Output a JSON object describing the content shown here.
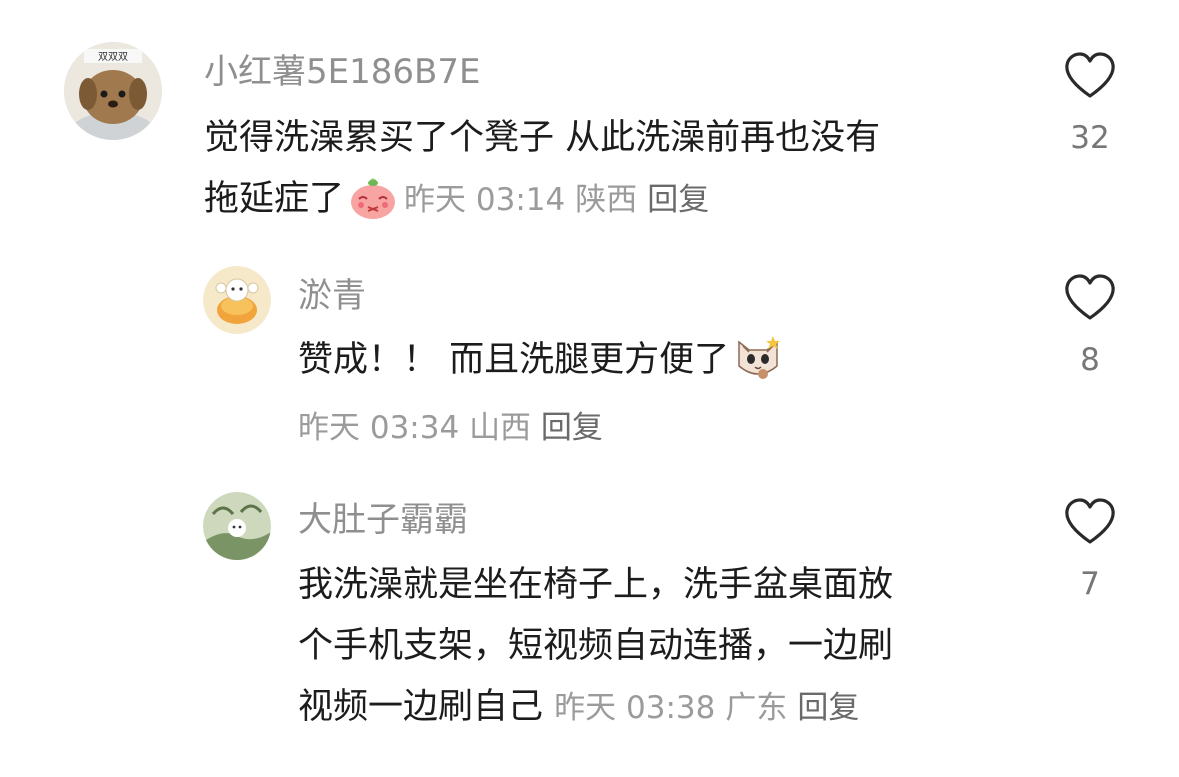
{
  "comments": [
    {
      "username": "小红薯5E186B7E",
      "text_line1": "觉得洗澡累买了个凳子 从此洗澡前再也没有",
      "text_line2": "拖延症了",
      "avatar_caption": "双双双",
      "time": "昨天 03:14",
      "location": "陕西",
      "reply_label": "回复",
      "likes": "32",
      "emoji": "blushing-strawberry-emoji"
    },
    {
      "username": "淤青",
      "text_line1": "赞成！！ 而且洗腿更方便了",
      "time": "昨天 03:34",
      "location": "山西",
      "reply_label": "回复",
      "likes": "8",
      "emoji": "cat-face-emoji"
    },
    {
      "username": "大肚子霸霸",
      "text_line1": "我洗澡就是坐在椅子上，洗手盆桌面放",
      "text_line2": "个手机支架，短视频自动连播，一边刷",
      "text_line3": "视频一边刷自己",
      "time": "昨天 03:38",
      "location": "广东",
      "reply_label": "回复",
      "likes": "7"
    }
  ],
  "colors": {
    "username": "#8f8f8f",
    "meta": "#9b9b9b",
    "text": "#1c1c1c"
  }
}
